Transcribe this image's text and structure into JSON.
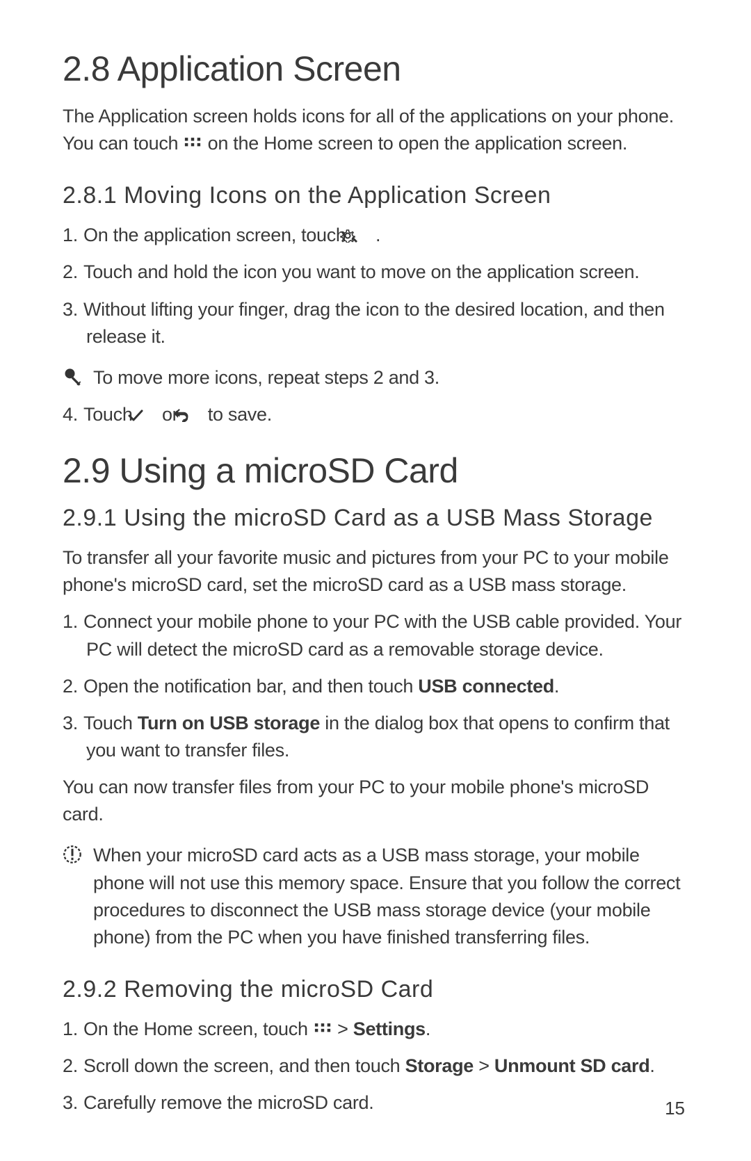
{
  "section28": {
    "title": "2.8  Application Screen",
    "intro_a": "The Application screen holds icons for all of the applications on your phone. You can touch ",
    "intro_b": " on the Home screen to open the application screen.",
    "sub281": {
      "title": "2.8.1  Moving Icons on the Application Screen",
      "step1_a": "On the application screen, touch ",
      "step1_b": " .",
      "step2": "Touch and hold the icon you want to move on the application screen.",
      "step3": "Without lifting your finger, drag the icon to the desired location, and then release it.",
      "note": "To move more icons, repeat steps 2 and 3.",
      "step4_a": "Touch ",
      "step4_b": " or ",
      "step4_c": " to save."
    }
  },
  "section29": {
    "title": "2.9  Using a microSD Card",
    "sub291": {
      "title": "2.9.1  Using the microSD Card as a USB Mass Storage",
      "intro": "To transfer all your favorite music and pictures from your PC to your mobile phone's microSD card, set the microSD card as a USB mass storage.",
      "step1": "Connect your mobile phone to your PC with the USB cable provided. Your PC will detect the microSD card as a removable storage device.",
      "step2_a": "Open the notification bar, and then touch ",
      "step2_bold": "USB connected",
      "step2_b": ".",
      "step3_a": "Touch ",
      "step3_bold": "Turn on USB storage",
      "step3_b": " in the dialog box that opens to confirm that you want to transfer files.",
      "after": "You can now transfer files from your PC to your mobile phone's microSD card.",
      "warning": "When your microSD card acts as a USB mass storage, your mobile phone will not use this memory space. Ensure that you follow the correct procedures to disconnect the USB mass storage device (your mobile phone) from the PC when you have finished transferring files."
    },
    "sub292": {
      "title": "2.9.2  Removing the microSD Card",
      "step1_a": "On the Home screen, touch ",
      "step1_b": " > ",
      "step1_bold": "Settings",
      "step1_c": ".",
      "step2_a": "Scroll down the screen, and then touch ",
      "step2_bold1": "Storage",
      "step2_mid": " > ",
      "step2_bold2": "Unmount SD card",
      "step2_b": ".",
      "step3": "Carefully remove the microSD card."
    }
  },
  "page_number": "15"
}
